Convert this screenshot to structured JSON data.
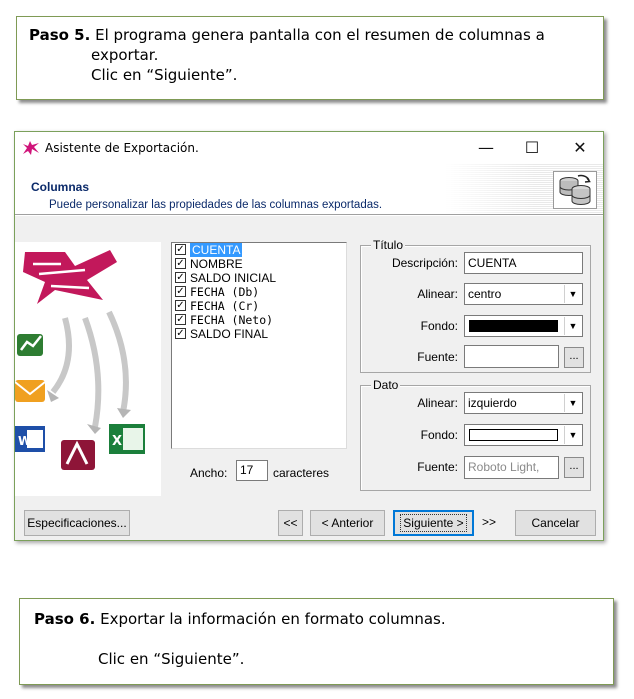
{
  "step5": {
    "label": "Paso 5.",
    "line1": "El programa genera pantalla con el resumen de columnas a",
    "line2": "exportar.",
    "line3": "Clic en “Siguiente”."
  },
  "step6": {
    "label": "Paso 6.",
    "line1": "Exportar la información en formato columnas.",
    "line2": "Clic en “Siguiente”."
  },
  "dialog": {
    "title": "Asistente de Exportación.",
    "minimize_glyph": "—",
    "maximize_glyph": "☐",
    "close_glyph": "✕",
    "header_title": "Columnas",
    "header_subtitle": "Puede personalizar las propiedades de las columnas exportadas.",
    "columns": [
      {
        "label": "CUENTA",
        "checked": true,
        "selected": true,
        "mono": false
      },
      {
        "label": "NOMBRE",
        "checked": true,
        "selected": false,
        "mono": false
      },
      {
        "label": "SALDO INICIAL",
        "checked": true,
        "selected": false,
        "mono": false
      },
      {
        "label": "FECHA (Db)",
        "checked": true,
        "selected": false,
        "mono": true
      },
      {
        "label": "FECHA (Cr)",
        "checked": true,
        "selected": false,
        "mono": true
      },
      {
        "label": "FECHA (Neto)",
        "checked": true,
        "selected": false,
        "mono": true
      },
      {
        "label": "SALDO FINAL",
        "checked": true,
        "selected": false,
        "mono": false
      }
    ],
    "check_glyph": "✓",
    "ancho_label": "Ancho:",
    "ancho_value": "17",
    "ancho_units": "caracteres",
    "titulo": {
      "legend": "Título",
      "descripcion_label": "Descripción:",
      "descripcion_value": "CUENTA",
      "alinear_label": "Alinear:",
      "alinear_value": "centro",
      "fondo_label": "Fondo:",
      "fondo_color": "#000000",
      "fuente_label": "Fuente:",
      "fuente_value": ""
    },
    "dato": {
      "legend": "Dato",
      "alinear_label": "Alinear:",
      "alinear_value": "izquierdo",
      "fondo_label": "Fondo:",
      "fondo_color": "#ffffff",
      "fuente_label": "Fuente:",
      "fuente_value": "Roboto Light, ",
      "fuente_color": "#8a8a8a"
    },
    "ellipsis": "...",
    "dropdown_arrow": "▼",
    "buttons": {
      "especificaciones": "Especificaciones...",
      "first": "<<",
      "anterior": "< Anterior",
      "siguiente": "Siguiente >",
      "last": ">>",
      "cancelar": "Cancelar"
    },
    "colors": {
      "header_text": "#0b2a6a",
      "selection": "#3399ff",
      "frame_border": "#7ba05b"
    }
  }
}
